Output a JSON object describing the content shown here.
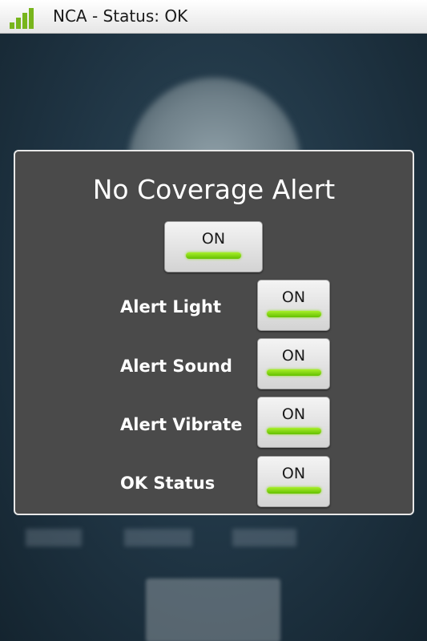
{
  "status_bar": {
    "title": "NCA - Status: OK",
    "icon": "signal-bars-icon",
    "signal_color": "#78b51c"
  },
  "dialog": {
    "title": "No Coverage Alert",
    "master_toggle": {
      "label": "ON",
      "state": "on"
    },
    "rows": [
      {
        "label": "Alert Light",
        "toggle_label": "ON",
        "state": "on"
      },
      {
        "label": "Alert Sound",
        "toggle_label": "ON",
        "state": "on"
      },
      {
        "label": "Alert Vibrate",
        "toggle_label": "ON",
        "state": "on"
      },
      {
        "label": "OK Status",
        "toggle_label": "ON",
        "state": "on"
      }
    ],
    "indicator_color": "#7ed321"
  }
}
